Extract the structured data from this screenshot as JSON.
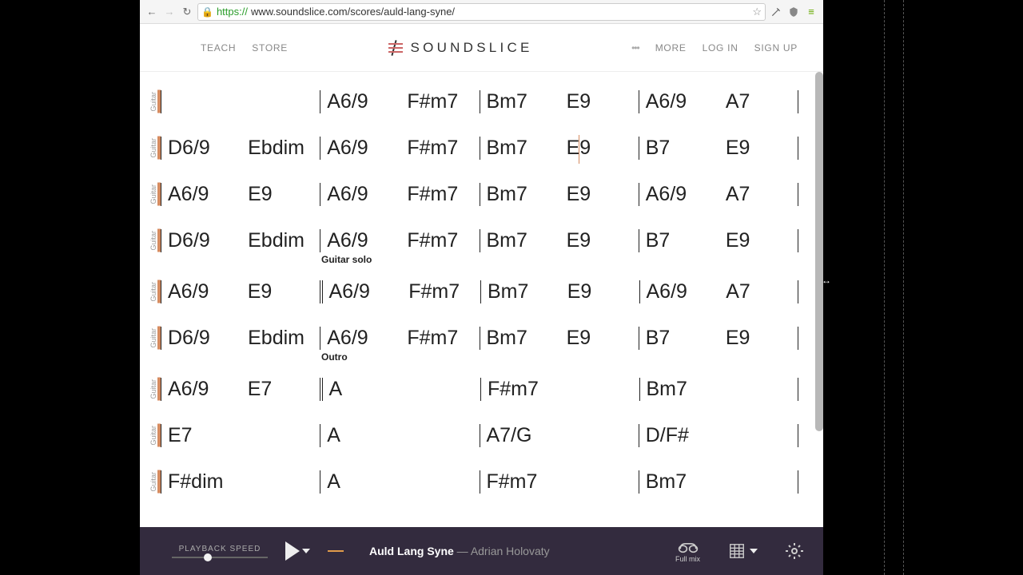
{
  "browser": {
    "url_https": "https://",
    "url_rest": "www.soundslice.com/scores/auld-lang-syne/"
  },
  "header": {
    "teach": "TEACH",
    "store": "STORE",
    "logo": "SOUNDSLICE",
    "more": "MORE",
    "login": "LOG IN",
    "signup": "SIGN UP"
  },
  "sheet": {
    "track_label": "Guitar",
    "section_solo": "Guitar solo",
    "section_outro": "Outro",
    "lines": [
      {
        "measures": [
          [
            "",
            ""
          ],
          [
            "A6/9",
            "F#m7"
          ],
          [
            "Bm7",
            "E9"
          ],
          [
            "A6/9",
            "A7"
          ]
        ]
      },
      {
        "measures": [
          [
            "D6/9",
            "Ebdim"
          ],
          [
            "A6/9",
            "F#m7"
          ],
          [
            "Bm7",
            "E9"
          ],
          [
            "B7",
            "E9"
          ]
        ],
        "cursor_at": 2
      },
      {
        "measures": [
          [
            "A6/9",
            "E9"
          ],
          [
            "A6/9",
            "F#m7"
          ],
          [
            "Bm7",
            "E9"
          ],
          [
            "A6/9",
            "A7"
          ]
        ]
      },
      {
        "measures": [
          [
            "D6/9",
            "Ebdim"
          ],
          [
            "A6/9",
            "F#m7"
          ],
          [
            "Bm7",
            "E9"
          ],
          [
            "B7",
            "E9"
          ]
        ]
      },
      {
        "section": "section_solo",
        "double_at": 1,
        "measures": [
          [
            "A6/9",
            "E9"
          ],
          [
            "A6/9",
            "F#m7"
          ],
          [
            "Bm7",
            "E9"
          ],
          [
            "A6/9",
            "A7"
          ]
        ]
      },
      {
        "measures": [
          [
            "D6/9",
            "Ebdim"
          ],
          [
            "A6/9",
            "F#m7"
          ],
          [
            "Bm7",
            "E9"
          ],
          [
            "B7",
            "E9"
          ]
        ]
      },
      {
        "section": "section_outro",
        "double_at": 1,
        "measures": [
          [
            "A6/9",
            "E7"
          ],
          [
            "A"
          ],
          [
            "F#m7"
          ],
          [
            "Bm7"
          ]
        ]
      },
      {
        "measures": [
          [
            "E7"
          ],
          [
            "A"
          ],
          [
            "A7/G"
          ],
          [
            "D/F#"
          ]
        ]
      },
      {
        "measures": [
          [
            "F#dim"
          ],
          [
            "A"
          ],
          [
            "F#m7"
          ],
          [
            "Bm7"
          ]
        ]
      }
    ]
  },
  "player": {
    "speed_label": "PLAYBACK SPEED",
    "song_title": "Auld Lang Syne",
    "song_sep": " — ",
    "song_artist": "Adrian Holovaty",
    "fullmix": "Full mix"
  }
}
